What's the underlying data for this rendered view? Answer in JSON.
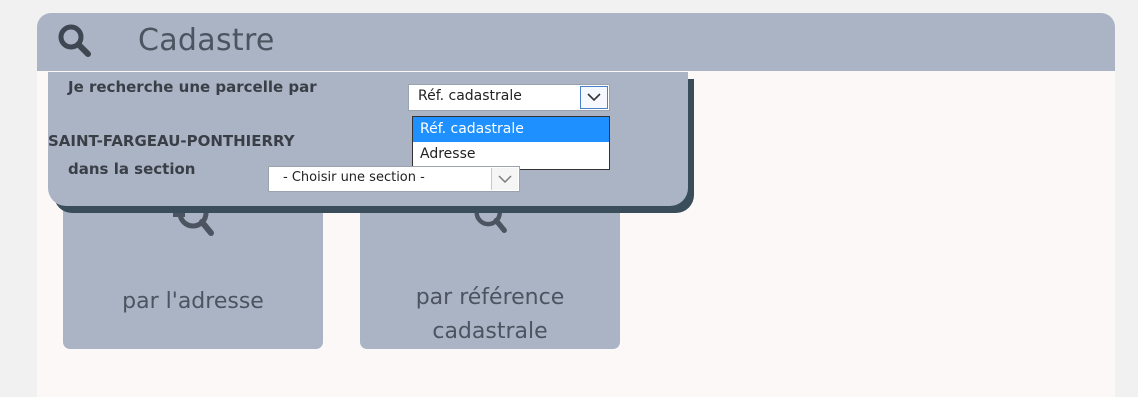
{
  "header": {
    "title": "Cadastre",
    "icon": "search-icon"
  },
  "popup": {
    "search_label": "Je recherche une parcelle par",
    "type_select": {
      "value": "Réf. cadastrale",
      "options": [
        "Réf. cadastrale",
        "Adresse"
      ],
      "highlighted": "Réf. cadastrale"
    },
    "commune": "SAINT-FARGEAU-PONTHIERRY",
    "section_label": "dans la section",
    "section_select": {
      "value": "- Choisir une section -"
    }
  },
  "tiles": {
    "address_label": "par l'adresse",
    "ref_label_line1": "par référence",
    "ref_label_line2": "cadastrale"
  },
  "colors": {
    "header_bg": "#aab4c4",
    "text_dark": "#4b5460",
    "highlight": "#1e90ff",
    "shadow": "#3a4d5b"
  }
}
